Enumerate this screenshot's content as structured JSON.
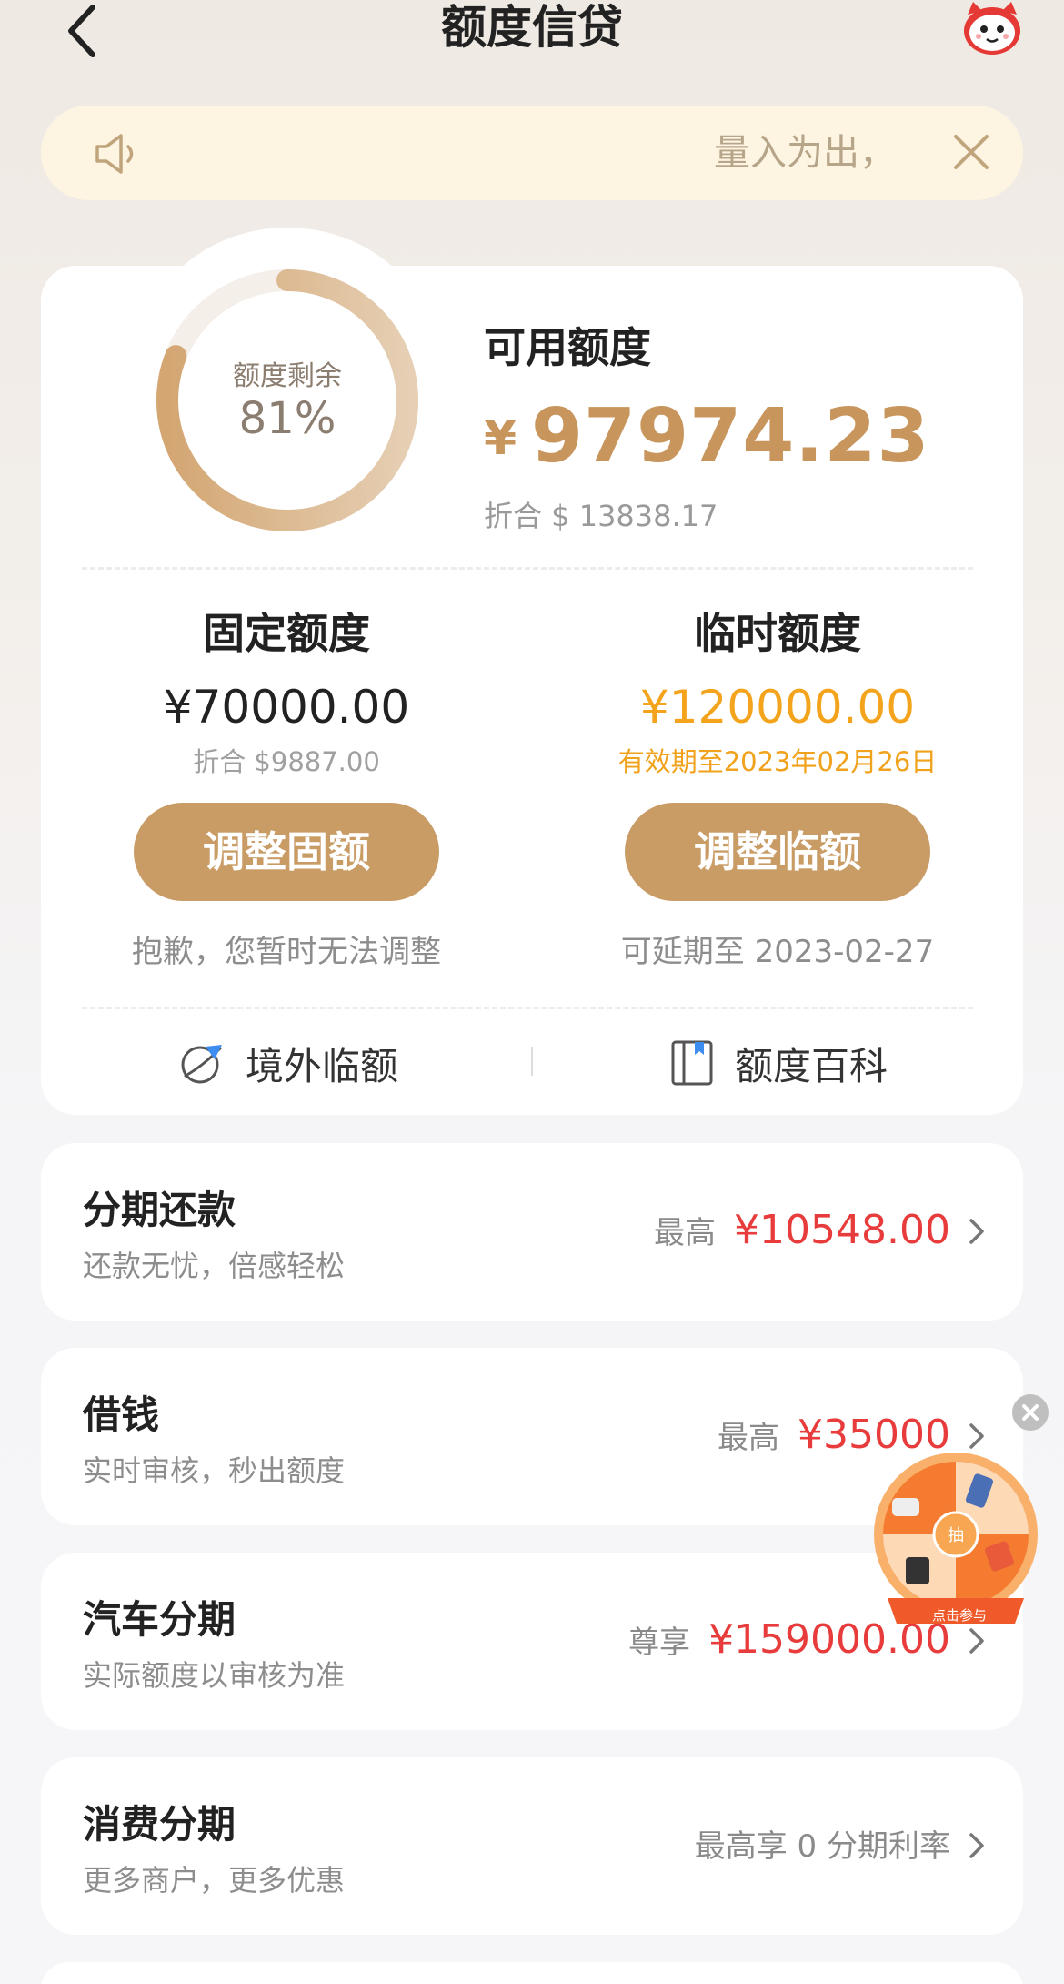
{
  "header": {
    "title": "额度信贷"
  },
  "notice": {
    "text": "量入为出，"
  },
  "available": {
    "ring_label": "额度剩余",
    "ring_percent": "81%",
    "ring_fraction": 0.81,
    "title": "可用额度",
    "currency": "¥",
    "amount": "97974.23",
    "converted": "折合 $ 13838.17"
  },
  "fixed": {
    "title": "固定额度",
    "amount": "¥70000.00",
    "converted": "折合 $9887.00",
    "button": "调整固额",
    "note": "抱歉，您暂时无法调整"
  },
  "temporary": {
    "title": "临时额度",
    "amount": "¥120000.00",
    "validity": "有效期至2023年02月26日",
    "button": "调整临额",
    "note": "可延期至 2023-02-27"
  },
  "links": {
    "overseas": "境外临额",
    "wiki": "额度百科"
  },
  "list": [
    {
      "title": "分期还款",
      "subtitle": "还款无忧，倍感轻松",
      "prefix": "最高",
      "value": "¥10548.00"
    },
    {
      "title": "借钱",
      "subtitle": "实时审核，秒出额度",
      "prefix": "最高",
      "value": "¥35000"
    },
    {
      "title": "汽车分期",
      "subtitle": "实际额度以审核为准",
      "prefix": "尊享",
      "value": "¥159000.00"
    },
    {
      "title": "消费分期",
      "subtitle": "更多商户，更多优惠",
      "prefix": "",
      "value": "最高享 0 分期利率"
    }
  ],
  "floating": {
    "center": "抽",
    "label": "点击参与"
  },
  "colors": {
    "gold": "#c99c66",
    "orange": "#f4a41c",
    "red": "#e83b3b"
  }
}
